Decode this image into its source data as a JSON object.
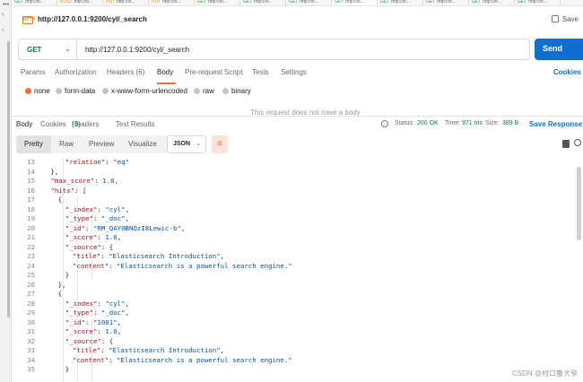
{
  "title_bar": {
    "request_title": "http://127.0.0.1:9200/cyl/_search",
    "save_label": "Save",
    "icon": "http-request-icon"
  },
  "tab_strip": {
    "tabs": [
      "GET http://lo...",
      "POST http://lo...",
      "PUT http://lo...",
      "PUT http://lo...",
      "GET http://lo...",
      "GET http://lo...",
      "GET http://lo...",
      "GET http://lo...",
      "GET http://lo...",
      "GET http://lo...",
      "GET http://lo...",
      "GET http://lo..."
    ]
  },
  "request": {
    "method": "GET",
    "url": "http://127.0.0.1:9200/cyl/_search",
    "send_label": "Send",
    "tabs": [
      {
        "label": "Params",
        "active": false
      },
      {
        "label": "Authorization",
        "active": false
      },
      {
        "label": "Headers (6)",
        "active": false
      },
      {
        "label": "Body",
        "active": true
      },
      {
        "label": "Pre-request Script",
        "active": false
      },
      {
        "label": "Tests",
        "active": false
      },
      {
        "label": "Settings",
        "active": false
      }
    ],
    "cookies_label": "Cookies",
    "body_types": [
      {
        "label": "none",
        "selected": true
      },
      {
        "label": "form-data",
        "selected": false
      },
      {
        "label": "x-www-form-urlencoded",
        "selected": false
      },
      {
        "label": "raw",
        "selected": false
      },
      {
        "label": "binary",
        "selected": false
      }
    ],
    "no_body_message": "This request does not have a body"
  },
  "response": {
    "tabs": [
      {
        "label": "Body",
        "active": true
      },
      {
        "label": "Cookies",
        "active": false
      },
      {
        "label": "Headers",
        "count": "(3)",
        "active": false
      },
      {
        "label": "Test Results",
        "active": false
      }
    ],
    "status_label": "Status:",
    "status_value": "200 OK",
    "time_label": "Time:",
    "time_value": "971 ms",
    "size_label": "Size:",
    "size_value": "389 B",
    "save_response_label": "Save Response",
    "view_modes": [
      "Pretty",
      "Raw",
      "Preview",
      "Visualize"
    ],
    "active_view": "Pretty",
    "format": "JSON",
    "lines": [
      {
        "n": "13",
        "indent": 4,
        "parts": [
          [
            "k",
            "\"relation\""
          ],
          [
            "p",
            ": "
          ],
          [
            "s",
            "\"eq\""
          ]
        ]
      },
      {
        "n": "14",
        "indent": 2,
        "parts": [
          [
            "p",
            "},"
          ]
        ]
      },
      {
        "n": "15",
        "indent": 2,
        "parts": [
          [
            "k",
            "\"max_score\""
          ],
          [
            "p",
            ": "
          ],
          [
            "s",
            "1.0"
          ],
          [
            "p",
            ","
          ]
        ]
      },
      {
        "n": "16",
        "indent": 2,
        "parts": [
          [
            "k",
            "\"hits\""
          ],
          [
            "p",
            ": ["
          ]
        ]
      },
      {
        "n": "17",
        "indent": 3,
        "parts": [
          [
            "p",
            "{"
          ]
        ]
      },
      {
        "n": "18",
        "indent": 4,
        "parts": [
          [
            "k",
            "\"_index\""
          ],
          [
            "p",
            ": "
          ],
          [
            "s",
            "\"cyl\""
          ],
          [
            "p",
            ","
          ]
        ]
      },
      {
        "n": "19",
        "indent": 4,
        "parts": [
          [
            "k",
            "\"_type\""
          ],
          [
            "p",
            ": "
          ],
          [
            "s",
            "\"_doc\""
          ],
          [
            "p",
            ","
          ]
        ]
      },
      {
        "n": "20",
        "indent": 4,
        "parts": [
          [
            "k",
            "\"_id\""
          ],
          [
            "p",
            ": "
          ],
          [
            "s",
            "\"RM_QAY0BNQzI8Lewic-b\""
          ],
          [
            "p",
            ","
          ]
        ]
      },
      {
        "n": "21",
        "indent": 4,
        "parts": [
          [
            "k",
            "\"_score\""
          ],
          [
            "p",
            ": "
          ],
          [
            "s",
            "1.0"
          ],
          [
            "p",
            ","
          ]
        ]
      },
      {
        "n": "22",
        "indent": 4,
        "parts": [
          [
            "k",
            "\"_source\""
          ],
          [
            "p",
            ": {"
          ]
        ]
      },
      {
        "n": "23",
        "indent": 5,
        "parts": [
          [
            "k",
            "\"title\""
          ],
          [
            "p",
            ": "
          ],
          [
            "s",
            "\"Elasticsearch Introduction\""
          ],
          [
            "p",
            ","
          ]
        ]
      },
      {
        "n": "24",
        "indent": 5,
        "parts": [
          [
            "k",
            "\"content\""
          ],
          [
            "p",
            ": "
          ],
          [
            "s",
            "\"Elasticsearch is a powerful search engine.\""
          ]
        ]
      },
      {
        "n": "25",
        "indent": 4,
        "parts": [
          [
            "p",
            "}"
          ]
        ]
      },
      {
        "n": "26",
        "indent": 3,
        "parts": [
          [
            "p",
            "},"
          ]
        ]
      },
      {
        "n": "27",
        "indent": 3,
        "parts": [
          [
            "p",
            "{"
          ]
        ]
      },
      {
        "n": "28",
        "indent": 4,
        "parts": [
          [
            "k",
            "\"_index\""
          ],
          [
            "p",
            ": "
          ],
          [
            "s",
            "\"cyl\""
          ],
          [
            "p",
            ","
          ]
        ]
      },
      {
        "n": "29",
        "indent": 4,
        "parts": [
          [
            "k",
            "\"_type\""
          ],
          [
            "p",
            ": "
          ],
          [
            "s",
            "\"_doc\""
          ],
          [
            "p",
            ","
          ]
        ]
      },
      {
        "n": "30",
        "indent": 4,
        "parts": [
          [
            "k",
            "\"_id\""
          ],
          [
            "p",
            ": "
          ],
          [
            "s",
            "\"1001\""
          ],
          [
            "p",
            ","
          ]
        ]
      },
      {
        "n": "31",
        "indent": 4,
        "parts": [
          [
            "k",
            "\"_score\""
          ],
          [
            "p",
            ": "
          ],
          [
            "s",
            "1.0"
          ],
          [
            "p",
            ","
          ]
        ]
      },
      {
        "n": "32",
        "indent": 4,
        "parts": [
          [
            "k",
            "\"_source\""
          ],
          [
            "p",
            ": {"
          ]
        ]
      },
      {
        "n": "33",
        "indent": 5,
        "parts": [
          [
            "k",
            "\"title\""
          ],
          [
            "p",
            ": "
          ],
          [
            "s",
            "\"Elasticsearch Introduction\""
          ],
          [
            "p",
            ","
          ]
        ]
      },
      {
        "n": "34",
        "indent": 5,
        "parts": [
          [
            "k",
            "\"content\""
          ],
          [
            "p",
            ": "
          ],
          [
            "s",
            "\"Elasticsearch is a powerful search engine.\""
          ]
        ]
      },
      {
        "n": "35",
        "indent": 4,
        "parts": [
          [
            "p",
            "}"
          ]
        ]
      }
    ]
  },
  "watermark": "CSDN @村口曹大爷",
  "colors": {
    "accent": "#ff6c37",
    "send_button": "#0e6fd0",
    "status_ok": "#0b7a3f",
    "json_key": "#a31515",
    "json_value": "#0451a5"
  }
}
